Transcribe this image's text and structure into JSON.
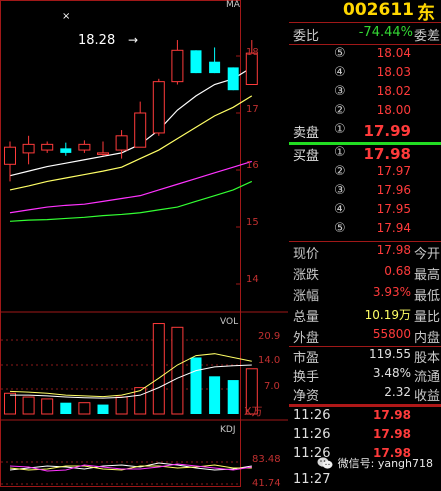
{
  "stock": {
    "code": "002611",
    "name_partial": "东"
  },
  "colors": {
    "bg": "#000000",
    "up": "#ff3b3b",
    "down": "#00ffff",
    "ma_white": "#ffffff",
    "ma_yellow": "#ffff66",
    "ma_magenta": "#ff33ff",
    "ma_green": "#33ff33",
    "grid": "#8b1a1a",
    "border": "#a01818"
  },
  "price_chart": {
    "ma_tag": "MA",
    "peak_label": "18.28",
    "y_ticks": [
      "18",
      "17",
      "16",
      "15",
      "14"
    ],
    "x_marker": "×"
  },
  "volume_chart": {
    "label": "VOL",
    "y_ticks": [
      "20.9",
      "14.0",
      "7.0"
    ],
    "unit": "X万"
  },
  "kdj_chart": {
    "label": "KDJ",
    "y_ticks": [
      "83.48",
      "41.74"
    ]
  },
  "chart_data": [
    {
      "type": "candlestick",
      "title": "",
      "ylim": [
        14,
        18.6
      ],
      "ohlc": [
        {
          "o": 16.1,
          "h": 16.5,
          "l": 15.8,
          "c": 16.4
        },
        {
          "o": 16.3,
          "h": 16.6,
          "l": 16.1,
          "c": 16.45
        },
        {
          "o": 16.35,
          "h": 16.5,
          "l": 16.3,
          "c": 16.45
        },
        {
          "o": 16.38,
          "h": 16.48,
          "l": 16.25,
          "c": 16.3
        },
        {
          "o": 16.35,
          "h": 16.52,
          "l": 16.3,
          "c": 16.45
        },
        {
          "o": 16.3,
          "h": 16.5,
          "l": 16.25,
          "c": 16.3
        },
        {
          "o": 16.35,
          "h": 16.7,
          "l": 16.2,
          "c": 16.6
        },
        {
          "o": 16.4,
          "h": 17.2,
          "l": 16.4,
          "c": 17.0
        },
        {
          "o": 16.65,
          "h": 17.6,
          "l": 16.6,
          "c": 17.55
        },
        {
          "o": 17.55,
          "h": 18.28,
          "l": 17.5,
          "c": 18.1
        },
        {
          "o": 18.1,
          "h": 18.1,
          "l": 17.7,
          "c": 17.7
        },
        {
          "o": 17.9,
          "h": 18.15,
          "l": 17.7,
          "c": 17.7
        },
        {
          "o": 17.8,
          "h": 17.8,
          "l": 17.4,
          "c": 17.4
        },
        {
          "o": 17.5,
          "h": 18.28,
          "l": 17.5,
          "c": 18.05
        }
      ],
      "ma": [
        {
          "color": "white",
          "values": [
            15.9,
            15.98,
            16.06,
            16.12,
            16.18,
            16.24,
            16.3,
            16.45,
            16.7,
            17.05,
            17.3,
            17.5,
            17.6,
            17.8
          ]
        },
        {
          "color": "yellow",
          "values": [
            15.65,
            15.72,
            15.8,
            15.86,
            15.92,
            15.98,
            16.05,
            16.2,
            16.35,
            16.55,
            16.75,
            16.95,
            17.1,
            17.3
          ]
        },
        {
          "color": "magenta",
          "values": [
            15.25,
            15.3,
            15.35,
            15.38,
            15.4,
            15.45,
            15.5,
            15.55,
            15.65,
            15.75,
            15.85,
            15.95,
            16.05,
            16.15
          ]
        },
        {
          "color": "green",
          "values": [
            15.1,
            15.12,
            15.13,
            15.15,
            15.17,
            15.2,
            15.22,
            15.25,
            15.3,
            15.35,
            15.45,
            15.55,
            15.65,
            15.8
          ]
        }
      ]
    },
    {
      "type": "bar",
      "title": "VOL",
      "ylim": [
        0,
        26
      ],
      "values": [
        5.5,
        4.5,
        4.0,
        3.0,
        3.0,
        2.5,
        4.5,
        7.0,
        24.0,
        23.0,
        15.0,
        10.0,
        9.0,
        12.0
      ],
      "up": [
        true,
        true,
        true,
        false,
        true,
        false,
        true,
        true,
        true,
        true,
        false,
        false,
        false,
        true
      ],
      "ma_yellow": [
        6.0,
        5.8,
        5.5,
        5.0,
        4.8,
        4.6,
        5.0,
        6.2,
        9.5,
        13.0,
        15.5,
        16.0,
        15.0,
        14.0
      ],
      "ma_white": [
        5.0,
        5.0,
        4.8,
        4.5,
        4.3,
        4.2,
        4.4,
        5.0,
        7.0,
        9.5,
        11.5,
        12.5,
        12.8,
        13.0
      ]
    }
  ],
  "orderbook": {
    "weibi_label": "委比",
    "weibi_value": "-74.44%",
    "weicha_label": "委差",
    "sell_label": "卖盘",
    "buy_label": "买盘",
    "sells": [
      {
        "level": "⑤",
        "price": "18.04"
      },
      {
        "level": "④",
        "price": "18.03"
      },
      {
        "level": "③",
        "price": "18.02"
      },
      {
        "level": "②",
        "price": "18.00"
      },
      {
        "level": "①",
        "price": "17.99"
      }
    ],
    "buys": [
      {
        "level": "①",
        "price": "17.98"
      },
      {
        "level": "②",
        "price": "17.97"
      },
      {
        "level": "③",
        "price": "17.96"
      },
      {
        "level": "④",
        "price": "17.95"
      },
      {
        "level": "⑤",
        "price": "17.94"
      }
    ]
  },
  "quote": [
    {
      "label": "现价",
      "value": "17.98",
      "side": "今开"
    },
    {
      "label": "涨跌",
      "value": "0.68",
      "side": "最高"
    },
    {
      "label": "涨幅",
      "value": "3.93%",
      "side": "最低"
    },
    {
      "label": "总量",
      "value": "10.19万",
      "side": "量比"
    },
    {
      "label": "外盘",
      "value": "55800",
      "side": "内盘"
    }
  ],
  "fundamentals": [
    {
      "label": "市盈",
      "value": "119.55",
      "side": "股本"
    },
    {
      "label": "换手",
      "value": "3.48%",
      "side": "流通"
    },
    {
      "label": "净资",
      "value": "2.32",
      "side": "收益"
    }
  ],
  "ticks": [
    {
      "time": "11:26",
      "price": "17.98"
    },
    {
      "time": "11:26",
      "price": "17.98"
    },
    {
      "time": "11:26",
      "price": "17.98"
    },
    {
      "time": "11:27",
      "price": ""
    }
  ],
  "watermark": {
    "text": "微信号: yangh718"
  }
}
